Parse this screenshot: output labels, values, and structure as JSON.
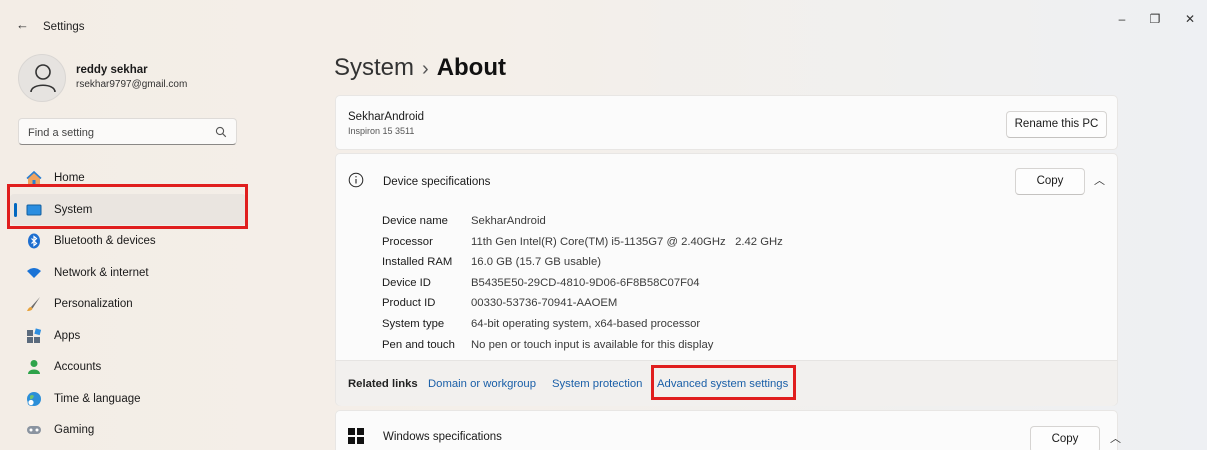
{
  "window": {
    "title": "Settings",
    "back_glyph": "←",
    "minimize_glyph": "–",
    "maximize_glyph": "❐",
    "close_glyph": "✕"
  },
  "profile": {
    "name": "reddy sekhar",
    "email": "rsekhar9797@gmail.com"
  },
  "search": {
    "placeholder": "Find a setting"
  },
  "sidebar": {
    "items": [
      {
        "label": "Home",
        "icon": "home-icon"
      },
      {
        "label": "System",
        "icon": "system-icon",
        "selected": true
      },
      {
        "label": "Bluetooth & devices",
        "icon": "bluetooth-icon"
      },
      {
        "label": "Network & internet",
        "icon": "wifi-icon"
      },
      {
        "label": "Personalization",
        "icon": "brush-icon"
      },
      {
        "label": "Apps",
        "icon": "apps-icon"
      },
      {
        "label": "Accounts",
        "icon": "person-icon"
      },
      {
        "label": "Time & language",
        "icon": "globe-icon"
      },
      {
        "label": "Gaming",
        "icon": "gamepad-icon"
      }
    ]
  },
  "breadcrumb": {
    "parent": "System",
    "separator": "›",
    "current": "About"
  },
  "pc": {
    "name": "SekharAndroid",
    "model": "Inspiron 15 3511",
    "rename_label": "Rename this PC"
  },
  "device_specs": {
    "title": "Device specifications",
    "copy_label": "Copy",
    "rows": [
      {
        "label": "Device name",
        "value": "SekharAndroid"
      },
      {
        "label": "Processor",
        "value": "11th Gen Intel(R) Core(TM) i5-1135G7 @ 2.40GHz   2.42 GHz"
      },
      {
        "label": "Installed RAM",
        "value": "16.0 GB (15.7 GB usable)"
      },
      {
        "label": "Device ID",
        "value": "B5435E50-29CD-4810-9D06-6F8B58C07F04"
      },
      {
        "label": "Product ID",
        "value": "00330-53736-70941-AAOEM"
      },
      {
        "label": "System type",
        "value": "64-bit operating system, x64-based processor"
      },
      {
        "label": "Pen and touch",
        "value": "No pen or touch input is available for this display"
      }
    ]
  },
  "related_links": {
    "label": "Related links",
    "links": [
      "Domain or workgroup",
      "System protection",
      "Advanced system settings"
    ]
  },
  "windows_specs": {
    "title": "Windows specifications",
    "copy_label": "Copy"
  },
  "colors": {
    "accent": "#0067c0",
    "highlight": "#e01e1e",
    "link": "#1a5fa8"
  }
}
